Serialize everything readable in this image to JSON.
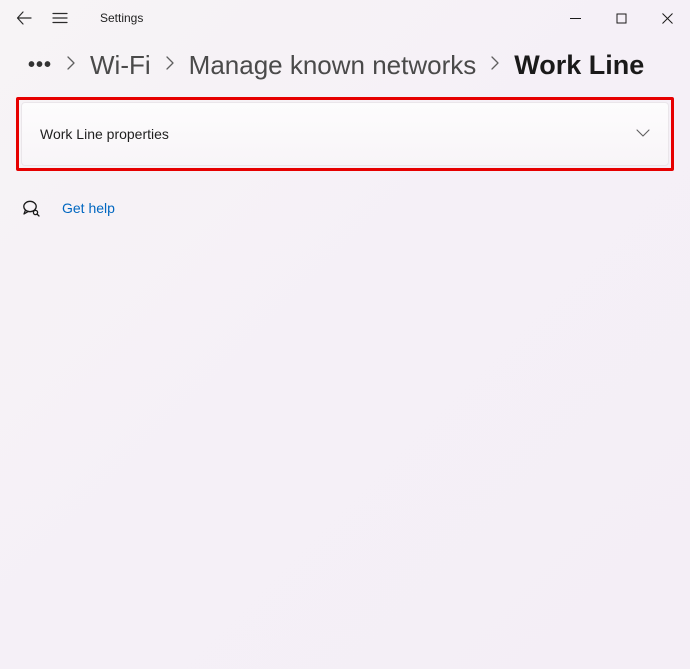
{
  "header": {
    "app_title": "Settings"
  },
  "breadcrumb": {
    "wifi": "Wi-Fi",
    "manage": "Manage known networks",
    "current": "Work Line"
  },
  "expander": {
    "label": "Work Line properties"
  },
  "help": {
    "label": "Get help"
  }
}
